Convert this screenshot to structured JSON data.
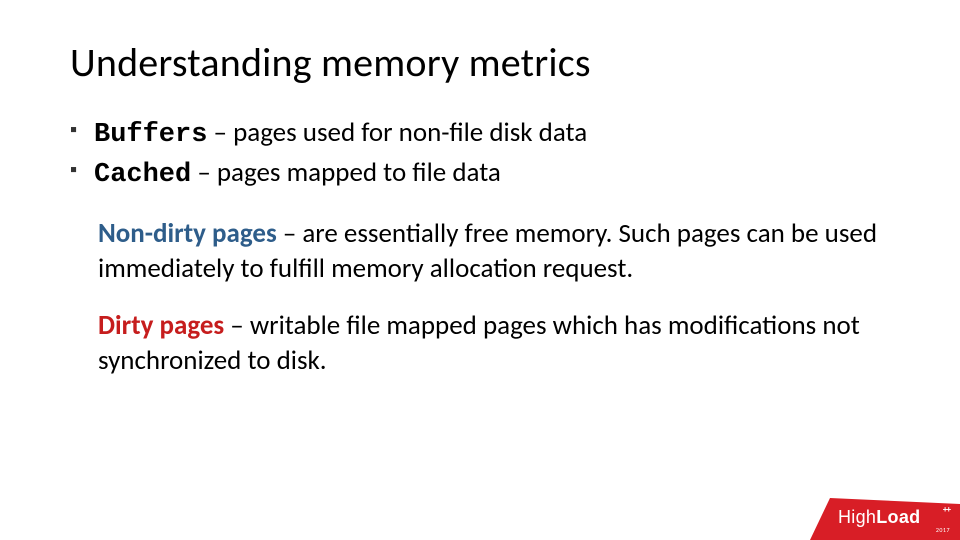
{
  "title": "Understanding memory metrics",
  "bullets": [
    {
      "term": "Buffers",
      "desc": " – pages used for non-file disk data"
    },
    {
      "term": "Cached",
      "desc": " – pages mapped to file data"
    }
  ],
  "para1": {
    "lead": "Non-dirty pages",
    "rest": " – are essentially free memory. Such pages can be used immediately to fulfill memory allocation request."
  },
  "para2": {
    "lead": "Dirty pages",
    "rest": " – writable file mapped pages which has modifications not synchronized to disk."
  },
  "logo": {
    "hi": "High",
    "load": "Load",
    "plus": "++",
    "year": "2017"
  },
  "colors": {
    "brand": "#d81e26",
    "steel": "#2e5d8a",
    "red": "#c61d1d"
  }
}
